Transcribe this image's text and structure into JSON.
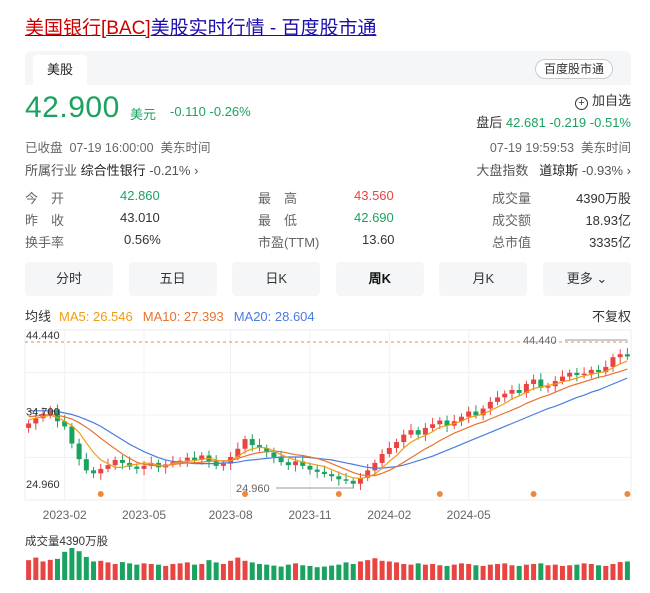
{
  "page": {
    "title_prefix": "美国银行[BAC]",
    "title_rest": "美股实时行情 - 百度股市通"
  },
  "tabs": {
    "active": "美股",
    "source": "百度股市通"
  },
  "quote": {
    "price": "42.900",
    "unit": "美元",
    "change": "-0.110",
    "change_pct": "-0.26%",
    "add_watch": "加自选",
    "after_hours_label": "盘后",
    "after_hours_price": "42.681",
    "after_hours_change": "-0.219",
    "after_hours_pct": "-0.51%",
    "status": "已收盘",
    "close_time": "07-19 16:00:00",
    "tz": "美东时间",
    "after_time": "07-19 19:59:53",
    "tz2": "美东时间",
    "industry_label": "所属行业",
    "industry": "综合性银行",
    "industry_chg": "-0.21%",
    "index_label": "大盘指数",
    "index_name": "道琼斯",
    "index_chg": "-0.93%"
  },
  "fields": [
    {
      "label": "今　开",
      "value": "42.860",
      "dir": "dn"
    },
    {
      "label": "最　高",
      "value": "43.560",
      "dir": "up"
    },
    {
      "label": "成交量",
      "value": "4390万股",
      "dir": ""
    },
    {
      "label": "昨　收",
      "value": "43.010",
      "dir": ""
    },
    {
      "label": "最　低",
      "value": "42.690",
      "dir": "dn"
    },
    {
      "label": "成交额",
      "value": "18.93亿",
      "dir": ""
    },
    {
      "label": "换手率",
      "value": "0.56%",
      "dir": ""
    },
    {
      "label": "市盈(TTM)",
      "value": "13.60",
      "dir": ""
    },
    {
      "label": "总市值",
      "value": "3335亿",
      "dir": ""
    }
  ],
  "periods": [
    "分时",
    "五日",
    "日K",
    "周K",
    "月K",
    "更多"
  ],
  "ma": {
    "label": "均线",
    "ma5": "MA5: 26.546",
    "ma10": "MA10: 27.393",
    "ma20": "MA20: 28.604",
    "adjust": "不复权"
  },
  "volume_label": "成交量4390万股",
  "colors": {
    "up": "#e84542",
    "down": "#1aa260",
    "ma5": "#f39c12",
    "ma10": "#e8732e",
    "ma20": "#4a7ce0"
  },
  "chart_data": {
    "type": "candlestick",
    "interval": "weekly",
    "y_ticks": [
      "44.440",
      "34.700",
      "24.960"
    ],
    "x_ticks": [
      "2023-02",
      "2023-05",
      "2023-08",
      "2023-11",
      "2024-02",
      "2024-05"
    ],
    "ylim": [
      24.96,
      44.44
    ],
    "max_label": "44.440",
    "min_label": "24.960",
    "close": [
      33.9,
      34.6,
      35.2,
      35.8,
      34.2,
      33.5,
      31.2,
      29.1,
      27.6,
      27.2,
      27.8,
      28.3,
      29.0,
      28.6,
      28.1,
      27.8,
      28.2,
      28.6,
      28.0,
      28.4,
      28.7,
      28.9,
      29.3,
      29.0,
      29.6,
      28.8,
      28.2,
      28.5,
      29.4,
      30.5,
      31.8,
      31.0,
      30.6,
      30.0,
      29.4,
      28.7,
      28.3,
      28.8,
      28.2,
      27.7,
      27.4,
      27.1,
      26.8,
      26.4,
      26.2,
      25.8,
      26.6,
      27.6,
      28.6,
      29.8,
      30.6,
      31.4,
      32.4,
      33.0,
      32.4,
      33.3,
      33.8,
      34.3,
      33.6,
      34.2,
      34.8,
      35.5,
      35.0,
      35.9,
      36.8,
      37.4,
      37.9,
      38.4,
      38.0,
      39.2,
      39.8,
      38.7,
      38.9,
      39.6,
      40.2,
      40.7,
      40.4,
      40.6,
      41.1,
      40.8,
      41.5,
      42.8,
      43.2,
      42.9
    ],
    "volume": [
      62,
      70,
      58,
      63,
      66,
      88,
      100,
      90,
      72,
      58,
      60,
      55,
      50,
      56,
      52,
      48,
      52,
      50,
      48,
      44,
      50,
      52,
      55,
      48,
      50,
      62,
      55,
      50,
      60,
      70,
      60,
      55,
      50,
      48,
      45,
      42,
      48,
      52,
      46,
      44,
      40,
      42,
      45,
      48,
      55,
      50,
      58,
      62,
      68,
      60,
      58,
      55,
      50,
      48,
      52,
      48,
      50,
      46,
      44,
      48,
      52,
      50,
      46,
      44,
      48,
      50,
      52,
      46,
      44,
      48,
      50,
      52,
      46,
      48,
      44,
      46,
      48,
      52,
      50,
      46,
      44,
      50,
      56,
      58
    ],
    "ma5": [
      34.4,
      34.6,
      34.8,
      35.0,
      34.7,
      34.2,
      33.6,
      32.7,
      31.3,
      30.0,
      29.0,
      28.5,
      28.0,
      28.0,
      28.3,
      28.4,
      28.6,
      28.5,
      28.3,
      28.2,
      28.5,
      28.7,
      28.8,
      28.9,
      29.1,
      29.2,
      29.0,
      28.8,
      28.9,
      29.5,
      30.1,
      30.5,
      30.7,
      30.6,
      30.2,
      29.7,
      29.3,
      29.0,
      28.7,
      28.5,
      28.3,
      28.1,
      27.7,
      27.3,
      26.9,
      26.6,
      26.5,
      26.7,
      27.1,
      27.9,
      28.8,
      29.6,
      30.6,
      31.4,
      31.9,
      32.3,
      32.8,
      33.4,
      33.6,
      33.9,
      34.2,
      34.7,
      34.9,
      35.2,
      35.6,
      36.1,
      36.6,
      37.2,
      37.6,
      38.1,
      38.6,
      38.8,
      39.0,
      39.2,
      39.5,
      39.7,
      40.0,
      40.3,
      40.5,
      40.7,
      40.9,
      41.4,
      41.9,
      42.3
    ],
    "ma10": [
      34.8,
      34.9,
      35.0,
      35.1,
      35.0,
      34.8,
      34.5,
      34.0,
      33.4,
      32.7,
      31.9,
      31.2,
      30.5,
      29.8,
      29.2,
      28.7,
      28.4,
      28.3,
      28.2,
      28.2,
      28.4,
      28.5,
      28.6,
      28.6,
      28.7,
      28.8,
      28.9,
      28.9,
      28.9,
      29.2,
      29.5,
      29.8,
      30.0,
      30.1,
      30.2,
      30.1,
      29.9,
      29.7,
      29.6,
      29.4,
      29.2,
      28.9,
      28.5,
      28.1,
      27.7,
      27.3,
      27.0,
      26.9,
      26.9,
      27.2,
      27.6,
      28.1,
      28.7,
      29.3,
      29.9,
      30.5,
      31.0,
      31.6,
      32.1,
      32.6,
      33.0,
      33.4,
      33.8,
      34.1,
      34.5,
      34.9,
      35.3,
      35.7,
      36.1,
      36.6,
      37.0,
      37.4,
      37.7,
      38.1,
      38.5,
      38.9,
      39.2,
      39.5,
      39.8,
      40.1,
      40.3,
      40.6,
      40.9,
      41.2
    ],
    "ma20": [
      35.6,
      35.6,
      35.6,
      35.6,
      35.5,
      35.3,
      35.1,
      34.8,
      34.4,
      34.0,
      33.5,
      32.9,
      32.3,
      31.7,
      31.1,
      30.6,
      30.1,
      29.7,
      29.3,
      29.0,
      28.8,
      28.7,
      28.6,
      28.5,
      28.5,
      28.5,
      28.5,
      28.6,
      28.6,
      28.7,
      28.9,
      29.0,
      29.1,
      29.2,
      29.3,
      29.4,
      29.4,
      29.4,
      29.4,
      29.3,
      29.2,
      29.1,
      29.0,
      28.8,
      28.6,
      28.4,
      28.2,
      28.0,
      27.9,
      27.9,
      28.0,
      28.1,
      28.3,
      28.6,
      28.9,
      29.2,
      29.5,
      29.9,
      30.3,
      30.7,
      31.1,
      31.5,
      31.9,
      32.3,
      32.7,
      33.1,
      33.5,
      33.9,
      34.3,
      34.7,
      35.1,
      35.5,
      35.9,
      36.2,
      36.6,
      37.0,
      37.4,
      37.7,
      38.1,
      38.4,
      38.8,
      39.2,
      39.6,
      40.0
    ],
    "markers_at": [
      10,
      30,
      43,
      57,
      70,
      83
    ]
  }
}
